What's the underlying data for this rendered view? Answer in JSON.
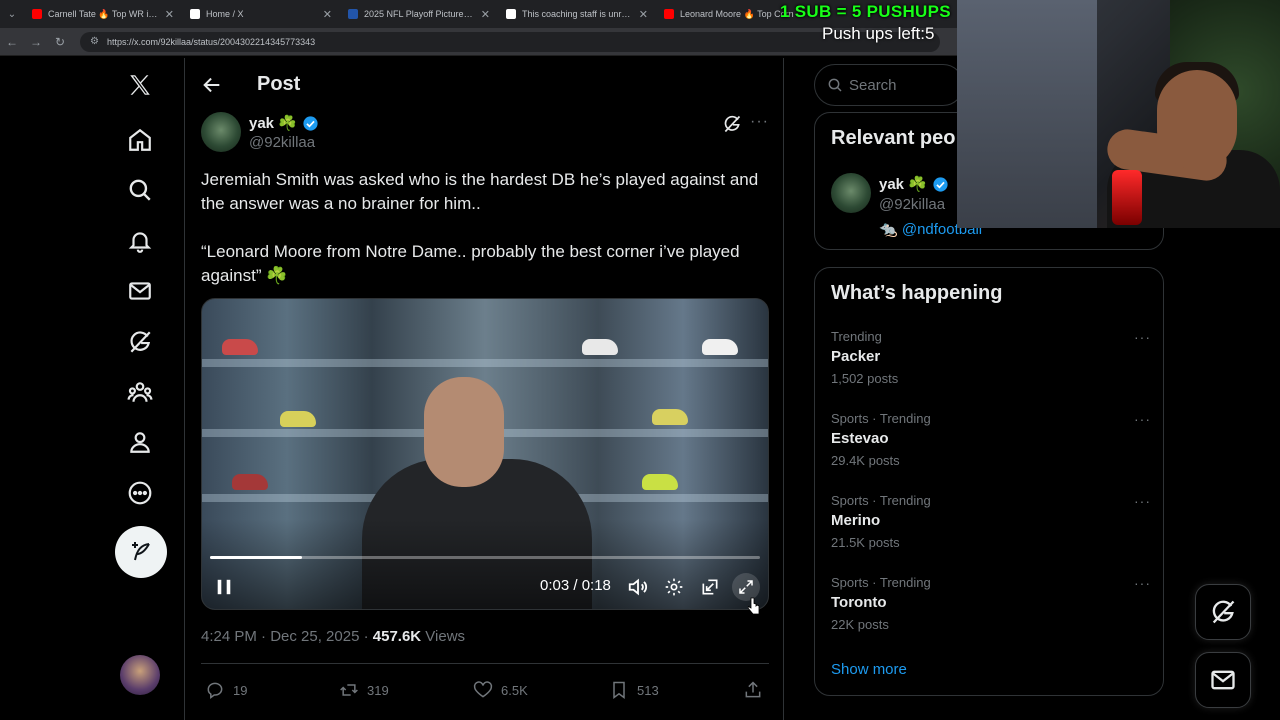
{
  "browser": {
    "tabs": [
      {
        "label": "Carnell Tate 🔥 Top WR in Colle",
        "favicon_color": "#ff0000",
        "active": false
      },
      {
        "label": "Home / X",
        "favicon_color": "#ffffff",
        "active": false
      },
      {
        "label": "2025 NFL Playoff Picture | NFL",
        "favicon_color": "#2255aa",
        "active": false
      },
      {
        "label": "This coaching staff is unreal 😩",
        "favicon_color": "#ffffff",
        "active": false
      },
      {
        "label": "Leonard Moore 🔥 Top Corn",
        "favicon_color": "#ff0000",
        "active": false
      },
      {
        "label": "",
        "favicon_color": "#ff0000",
        "active": true
      }
    ],
    "url": "https://x.com/92killaa/status/2004302214345773343"
  },
  "overlay": {
    "sub_text": "1 SUB = 5 PUSHUPS",
    "pushups_text": "Push ups left:5"
  },
  "header": {
    "title": "Post"
  },
  "post": {
    "author_name": "yak ☘️",
    "author_handle": "@92killaa",
    "text": "Jeremiah Smith was asked who is the hardest DB he’s played against and the answer was a no brainer for him..\n\n“Leonard Moore from Notre Dame.. probably the best corner i’ve played against” ☘️",
    "video": {
      "time": "0:03 / 0:18",
      "progress": 0.167
    },
    "timestamp": "4:24 PM · Dec 25, 2025 · ",
    "views_count": "457.6K",
    "views_label": " Views",
    "replies": "19",
    "reposts": "319",
    "likes": "6.5K",
    "bookmarks": "513"
  },
  "right": {
    "search_placeholder": "Search",
    "relevant_title": "Relevant peo",
    "relevant_person": {
      "name": "yak ☘️",
      "handle": "@92killaa",
      "bio": "🐀 @ndfootball"
    },
    "happening_title": "What’s happening",
    "trends": [
      {
        "context": "Trending",
        "name": "Packer",
        "count": "1,502 posts"
      },
      {
        "context": "Sports · Trending",
        "name": "Estevao",
        "count": "29.4K posts"
      },
      {
        "context": "Sports · Trending",
        "name": "Merino",
        "count": "21.5K posts"
      },
      {
        "context": "Sports · Trending",
        "name": "Toronto",
        "count": "22K posts"
      }
    ],
    "show_more": "Show more"
  },
  "colors": {
    "accent": "#1d9bf0",
    "overlay_green": "#18ff18"
  }
}
